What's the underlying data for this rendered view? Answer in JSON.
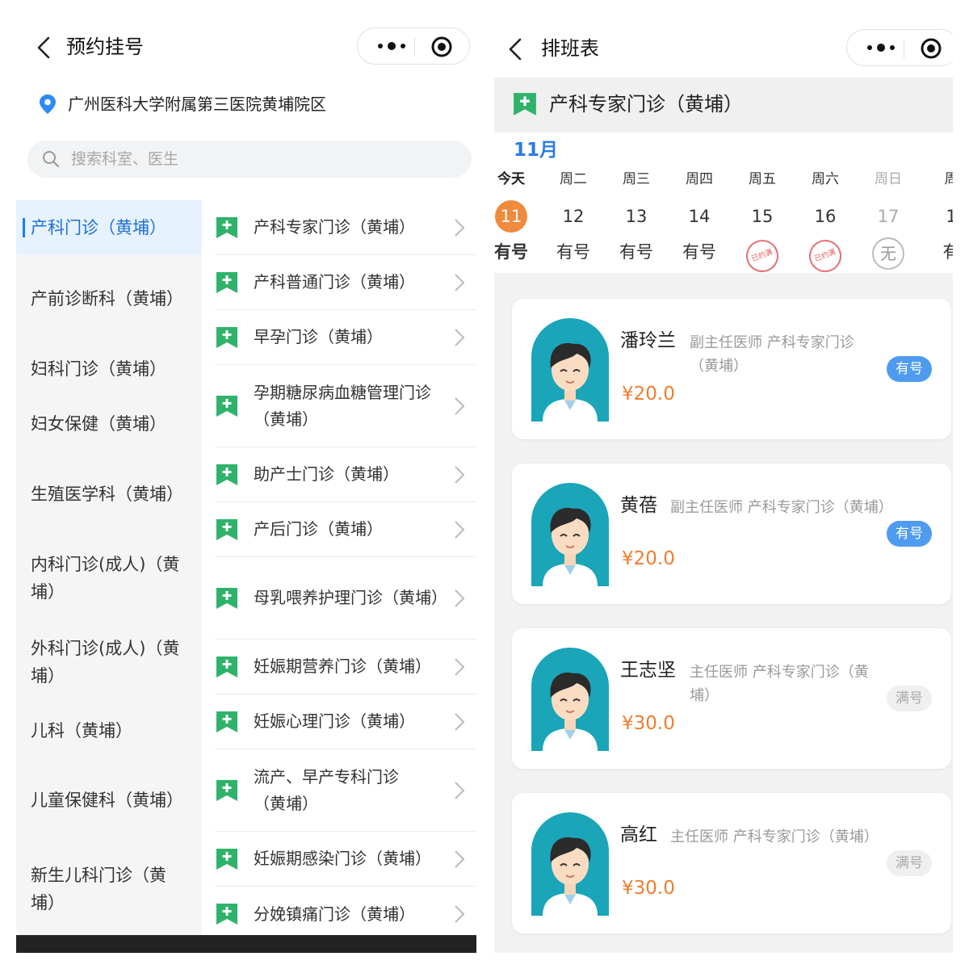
{
  "left": {
    "nav": {
      "title": "预约挂号"
    },
    "location": "广州医科大学附属第三医院黄埔院区",
    "search": {
      "placeholder": "搜索科室、医生"
    },
    "departments": [
      "产科门诊（黄埔）",
      "产前诊断科（黄埔）",
      "妇科门诊（黄埔）",
      "妇女保健（黄埔）",
      "生殖医学科（黄埔）",
      "内科门诊(成人)（黄埔）",
      "外科门诊(成人)（黄埔）",
      "儿科（黄埔）",
      "儿童保健科（黄埔）",
      "新生儿科门诊（黄埔）"
    ],
    "clinics": [
      "产科专家门诊（黄埔）",
      "产科普通门诊（黄埔）",
      "早孕门诊（黄埔）",
      "孕期糖尿病血糖管理门诊（黄埔）",
      "助产士门诊（黄埔）",
      "产后门诊（黄埔）",
      "母乳喂养护理门诊（黄埔）",
      "妊娠期营养门诊（黄埔）",
      "妊娠心理门诊（黄埔）",
      "流产、早产专科门诊（黄埔）",
      "妊娠期感染门诊（黄埔）",
      "分娩镇痛门诊（黄埔）"
    ]
  },
  "right": {
    "nav": {
      "title": "排班表"
    },
    "department": "产科专家门诊（黄埔）",
    "month": "11月",
    "days": [
      {
        "weekday": "今天",
        "date": "11",
        "status": "有号"
      },
      {
        "weekday": "周二",
        "date": "12",
        "status": "有号"
      },
      {
        "weekday": "周三",
        "date": "13",
        "status": "有号"
      },
      {
        "weekday": "周四",
        "date": "14",
        "status": "有号"
      },
      {
        "weekday": "周五",
        "date": "15",
        "status": "已约满"
      },
      {
        "weekday": "周六",
        "date": "16",
        "status": "已约满"
      },
      {
        "weekday": "周日",
        "date": "17",
        "status": "无"
      },
      {
        "weekday": "周",
        "date": "1",
        "status": "有"
      }
    ],
    "doctors": [
      {
        "name": "潘玲兰",
        "title": "副主任医师 产科专家门诊（黄埔）",
        "price": "¥20.0",
        "badge": "有号"
      },
      {
        "name": "黄蓓",
        "title": "副主任医师 产科专家门诊（黄埔）",
        "price": "¥20.0",
        "badge": "有号"
      },
      {
        "name": "王志坚",
        "title": "主任医师 产科专家门诊（黄埔）",
        "price": "¥30.0",
        "badge": "满号"
      },
      {
        "name": "高红",
        "title": "主任医师 产科专家门诊（黄埔）",
        "price": "¥30.0",
        "badge": "满号"
      }
    ]
  },
  "colors": {
    "accent_blue": "#1e7ef0",
    "clinic_green": "#2fb36b",
    "today_orange": "#f08a3c",
    "price_orange": "#f07c2e",
    "stamp_red": "#e05a5a"
  },
  "icons": [
    "back-icon",
    "more-icon",
    "target-icon",
    "location-pin-icon",
    "search-icon",
    "clinic-icon",
    "chevron-right-icon",
    "doctor-avatar"
  ]
}
